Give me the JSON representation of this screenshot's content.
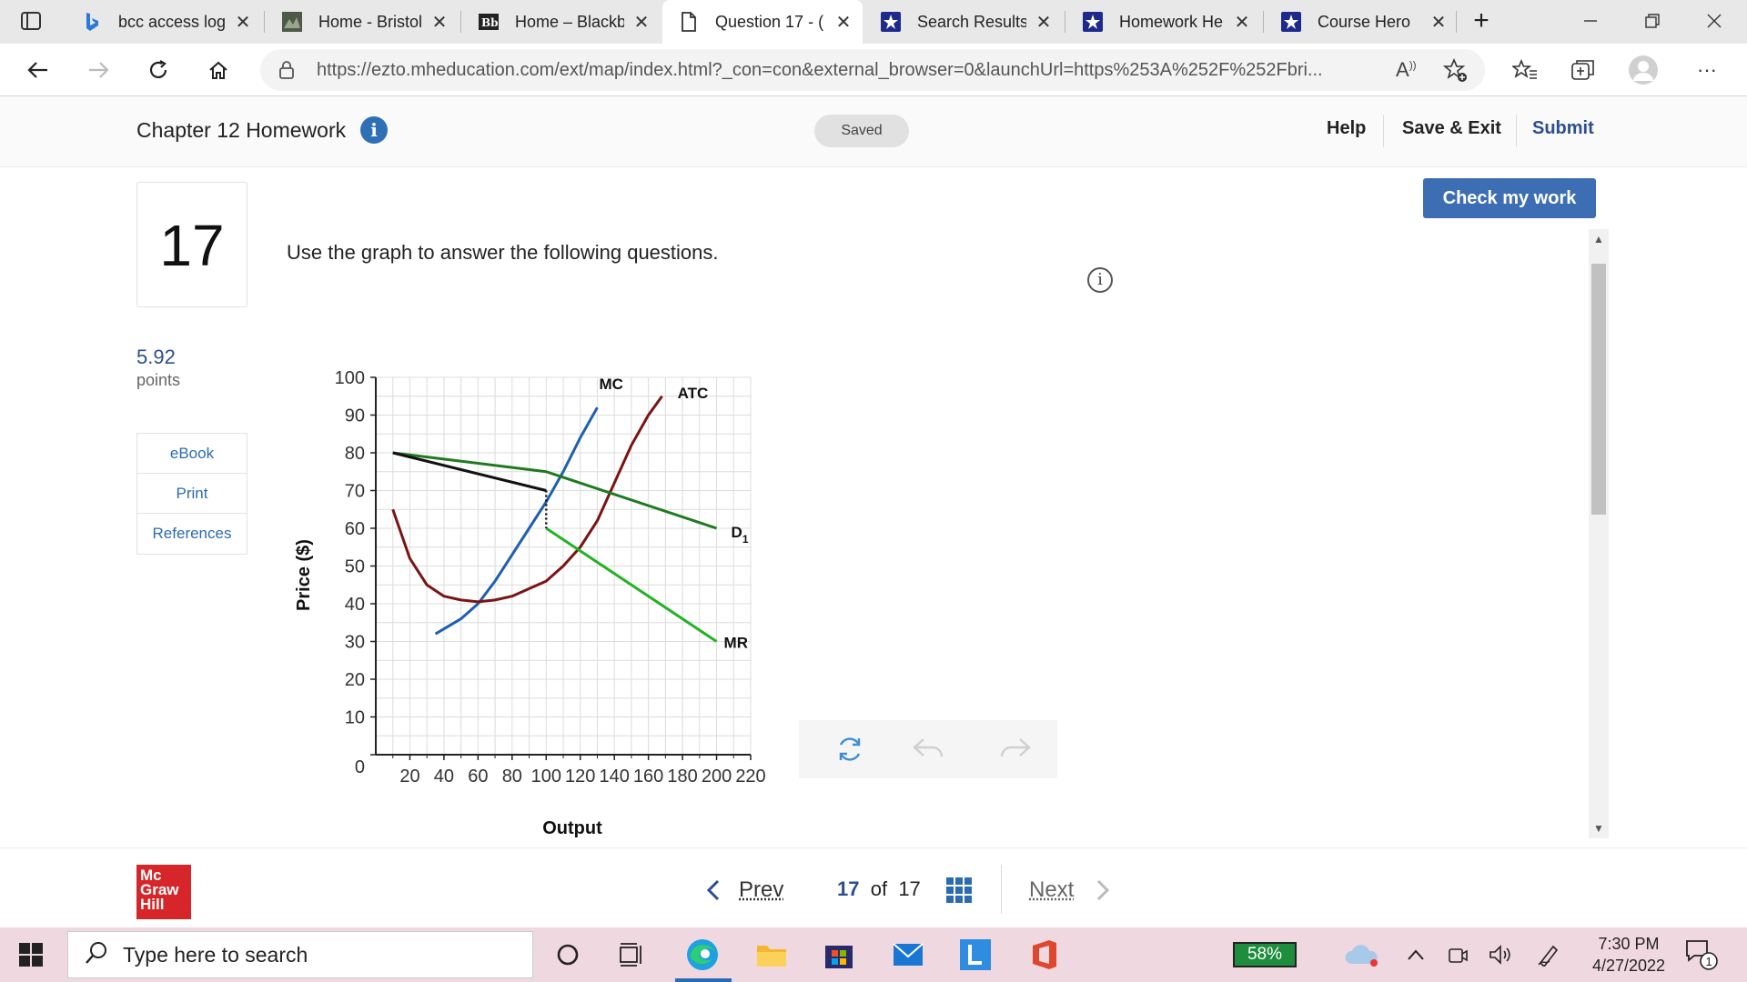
{
  "browser": {
    "tabs": [
      {
        "title": "bcc access logi",
        "icon": "bing-icon"
      },
      {
        "title": "Home - Bristol",
        "icon": "site-icon"
      },
      {
        "title": "Home – Blackb",
        "icon": "blackboard-icon"
      },
      {
        "title": "Question 17 - (",
        "icon": "page-icon",
        "active": true
      },
      {
        "title": "Search Results",
        "icon": "star-shield-icon"
      },
      {
        "title": "Homework He",
        "icon": "star-shield-icon"
      },
      {
        "title": "Course Hero",
        "icon": "star-shield-icon"
      }
    ],
    "url": "https://ezto.mheducation.com/ext/map/index.html?_con=con&external_browser=0&launchUrl=https%253A%252F%252Fbri..."
  },
  "header": {
    "title": "Chapter 12 Homework",
    "info": "i",
    "saved": "Saved",
    "help": "Help",
    "save_exit": "Save & Exit",
    "submit": "Submit"
  },
  "question": {
    "number": "17",
    "points_value": "5.92",
    "points_label": "points",
    "tools": [
      "eBook",
      "Print",
      "References"
    ],
    "prompt": "Use the graph to answer the following questions.",
    "check_button": "Check my work"
  },
  "chart_data": {
    "type": "line",
    "xlabel": "Output",
    "ylabel": "Price ($)",
    "xlim": [
      0,
      220
    ],
    "ylim": [
      0,
      100
    ],
    "x_ticks": [
      20,
      40,
      60,
      80,
      100,
      120,
      140,
      160,
      180,
      200,
      220
    ],
    "y_ticks": [
      0,
      10,
      20,
      30,
      40,
      50,
      60,
      70,
      80,
      90,
      100
    ],
    "grid": true,
    "series": [
      {
        "name": "MC",
        "color": "#1f5fb0",
        "points": [
          [
            35,
            32
          ],
          [
            50,
            36
          ],
          [
            60,
            40
          ],
          [
            70,
            46
          ],
          [
            80,
            53
          ],
          [
            90,
            60
          ],
          [
            100,
            67
          ],
          [
            110,
            75
          ],
          [
            120,
            84
          ],
          [
            130,
            92
          ]
        ]
      },
      {
        "name": "ATC",
        "color": "#7a1414",
        "points": [
          [
            10,
            65
          ],
          [
            20,
            52
          ],
          [
            30,
            45
          ],
          [
            40,
            42
          ],
          [
            50,
            41
          ],
          [
            60,
            40.5
          ],
          [
            70,
            41
          ],
          [
            80,
            42
          ],
          [
            90,
            44
          ],
          [
            100,
            46
          ],
          [
            110,
            50
          ],
          [
            120,
            55
          ],
          [
            130,
            62
          ],
          [
            140,
            72
          ],
          [
            150,
            82
          ],
          [
            160,
            90
          ],
          [
            168,
            95
          ]
        ]
      },
      {
        "name": "D1",
        "color": "#1f7a1f",
        "points": [
          [
            10,
            80
          ],
          [
            100,
            75
          ],
          [
            200,
            60
          ]
        ]
      },
      {
        "name": "MR",
        "color": "#22b222",
        "points": [
          [
            100,
            60
          ],
          [
            200,
            30
          ]
        ]
      },
      {
        "name": "",
        "color": "#111111",
        "points": [
          [
            10,
            80
          ],
          [
            100,
            70
          ]
        ]
      }
    ],
    "dotted_segment": [
      [
        100,
        70
      ],
      [
        100,
        60
      ]
    ]
  },
  "footer": {
    "prev": "Prev",
    "page_current": "17",
    "page_of": "of",
    "page_total": "17",
    "next": "Next",
    "logo": [
      "Mc",
      "Graw",
      "Hill"
    ]
  },
  "taskbar": {
    "search_placeholder": "Type here to search",
    "battery": "58%",
    "time": "7:30 PM",
    "date": "4/27/2022",
    "notification_count": "1"
  }
}
